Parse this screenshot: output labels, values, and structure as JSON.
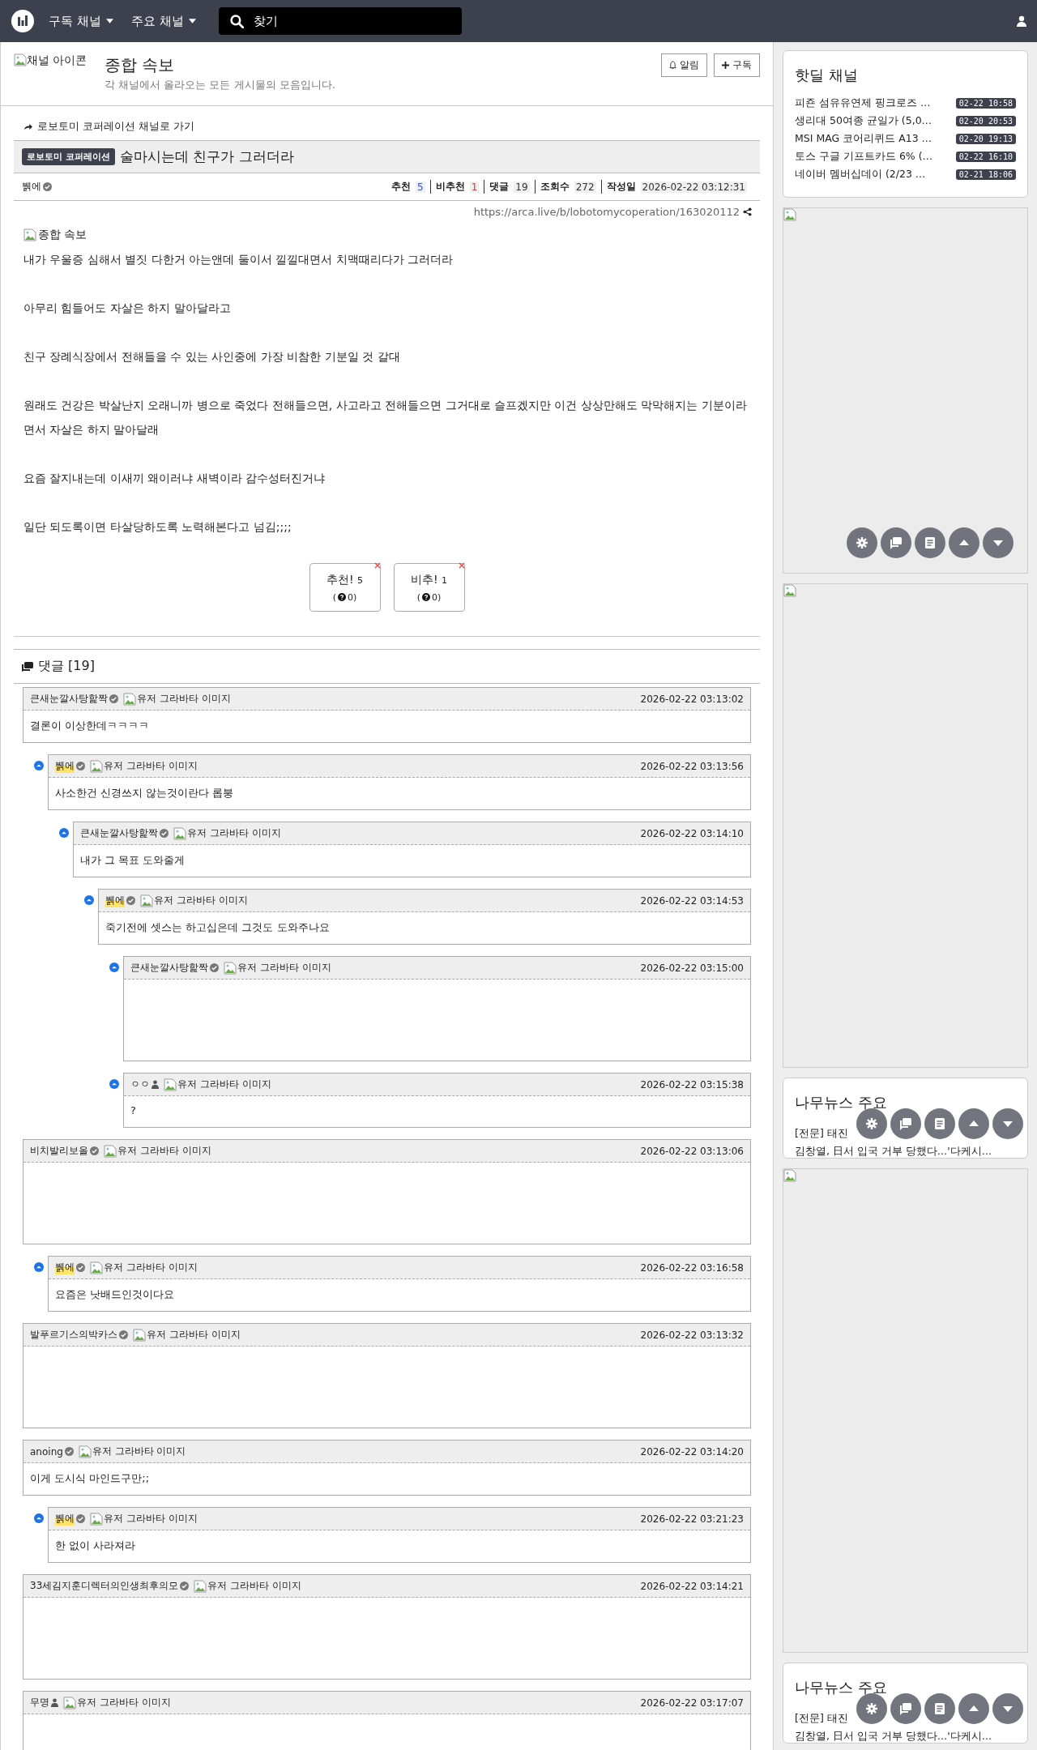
{
  "nav": {
    "menus": [
      {
        "label": "구독 채널"
      },
      {
        "label": "주요 채널"
      }
    ],
    "search": {
      "placeholder": "찾기"
    }
  },
  "channel": {
    "icon_alt": "채널 아이콘",
    "title": "종합 속보",
    "description": "각 채널에서 올라오는 모든 게시물의 모음입니다.",
    "buttons": [
      {
        "kind": "bell",
        "label": "알림"
      },
      {
        "kind": "plus",
        "label": "구독"
      }
    ]
  },
  "post": {
    "back_link": "로보토미 코퍼레이션 채널로 가기",
    "badge": "로보토미 코퍼레이션",
    "title": "술마시는데 친구가 그러더라",
    "author": "뷁에",
    "stats": [
      {
        "label": "추천",
        "value": "5",
        "color": "#3454d1"
      },
      {
        "label": "비추천",
        "value": "1",
        "color": "#d9363e"
      },
      {
        "label": "댓글",
        "value": "19",
        "color": "#333333"
      },
      {
        "label": "조회수",
        "value": "272",
        "color": "#333333"
      },
      {
        "label": "작성일",
        "value": "2026-02-22 03:12:31",
        "color": "#333333"
      }
    ],
    "url": "https://arca.live/b/lobotomycoperation/163020112",
    "image_alt": "종합 속보",
    "paragraphs": [
      "내가 우울증 심해서 별짓 다한거 아는앤데 둘이서 낄낄대면서 치맥때리다가 그러더라",
      "아무리 힘들어도 자살은 하지 말아달라고",
      "친구 장례식장에서 전해들을 수 있는 사인중에 가장 비참한 기분일 것 갈대",
      "원래도 건강은 박살난지 오래니까 병으로 죽었다 전해들으면, 사고라고 전해들으면 그거대로 슬프겠지만 이건 상상만해도 막막해지는 기분이라면서 자살은 하지 말아달래",
      "요즘 잘지내는데 이새끼 왜이러냐 새벽이라 감수성터진거냐",
      "일단 되도록이면 타살당하도록 노력해본다고 넘김;;;;"
    ],
    "votes": [
      {
        "label": "추천!",
        "count": "5",
        "tally_before": "(",
        "tally_after": "0)"
      },
      {
        "label": "비추!",
        "count": "1",
        "tally_before": "(",
        "tally_after": "0)"
      }
    ]
  },
  "comments": {
    "title": "댓글 [19]",
    "items": [
      {
        "author": "큰새눈깔사탕핥짝",
        "verified": true,
        "is_author": false,
        "avatar_alt": "유저 그라바타 이미지",
        "time": "2026-02-22 03:13:02",
        "kind": "text",
        "body": "결론이 이상한데ㅋㅋㅋㅋ",
        "children": [
          {
            "author": "뷁에",
            "verified": true,
            "is_author": true,
            "avatar_alt": "유저 그라바타 이미지",
            "time": "2026-02-22 03:13:56",
            "kind": "text",
            "body": "사소한건 신경쓰지 않는것이란다 롭붕",
            "children": [
              {
                "author": "큰새눈깔사탕핥짝",
                "verified": true,
                "is_author": false,
                "avatar_alt": "유저 그라바타 이미지",
                "time": "2026-02-22 03:14:10",
                "kind": "text",
                "body": "내가 그 목표 도와줄게",
                "children": [
                  {
                    "author": "뷁에",
                    "verified": true,
                    "is_author": true,
                    "avatar_alt": "유저 그라바타 이미지",
                    "time": "2026-02-22 03:14:53",
                    "kind": "text",
                    "body": "죽기전에 셋스는 하고십은데 그것도 도와주나요",
                    "children": [
                      {
                        "author": "큰새눈깔사탕핥짝",
                        "verified": true,
                        "is_author": false,
                        "avatar_alt": "유저 그라바타 이미지",
                        "time": "2026-02-22 03:15:00",
                        "kind": "blank"
                      },
                      {
                        "author": "ㅇㅇ",
                        "verified": false,
                        "is_author": false,
                        "avatar_alt": "유저 그라바타 이미지",
                        "time": "2026-02-22 03:15:38",
                        "kind": "text",
                        "body": "?"
                      }
                    ]
                  }
                ]
              }
            ]
          }
        ]
      },
      {
        "author": "비치발리보올",
        "verified": true,
        "is_author": false,
        "avatar_alt": "유저 그라바타 이미지",
        "time": "2026-02-22 03:13:06",
        "kind": "blank",
        "children": [
          {
            "author": "뷁에",
            "verified": true,
            "is_author": true,
            "avatar_alt": "유저 그라바타 이미지",
            "time": "2026-02-22 03:16:58",
            "kind": "text",
            "body": "요즘은 낫배드인것이다요"
          }
        ]
      },
      {
        "author": "발푸르기스의박카스",
        "verified": true,
        "is_author": false,
        "avatar_alt": "유저 그라바타 이미지",
        "time": "2026-02-22 03:13:32",
        "kind": "blank"
      },
      {
        "author": "anoing",
        "verified": true,
        "is_author": false,
        "avatar_alt": "유저 그라바타 이미지",
        "time": "2026-02-22 03:14:20",
        "kind": "text",
        "body": "이게 도시식 마인드구만;;",
        "children": [
          {
            "author": "뷁에",
            "verified": true,
            "is_author": true,
            "avatar_alt": "유저 그라바타 이미지",
            "time": "2026-02-22 03:21:23",
            "kind": "text",
            "body": "한 없이 사라져라"
          }
        ]
      },
      {
        "author": "33세김지훈디렉터의인생최후의모",
        "verified": true,
        "is_author": false,
        "avatar_alt": "유저 그라바타 이미지",
        "time": "2026-02-22 03:14:21",
        "kind": "blank"
      },
      {
        "author": "무명",
        "verified": false,
        "is_author": false,
        "avatar_alt": "유저 그라바타 이미지",
        "time": "2026-02-22 03:17:07",
        "kind": "blank"
      }
    ]
  },
  "sidebar": [
    {
      "kind": "hotdeal",
      "title": "핫딜 채널",
      "items": [
        {
          "title": "피죤 섬유유연제 핑크로즈 …",
          "time": "02-22 10:58"
        },
        {
          "title": "생리대 50여종 균일가 (5,0…",
          "time": "02-20 20:53"
        },
        {
          "title": "MSI MAG 코어리퀴드 A13 …",
          "time": "02-20 19:13"
        },
        {
          "title": "토스 구글 기프트카드 6% (…",
          "time": "02-22 16:10"
        },
        {
          "title": "네이버 멤버십데이 (2/23 …",
          "time": "02-21 18:06"
        }
      ],
      "float_bar": false
    },
    {
      "kind": "ad",
      "float_bar": true
    },
    {
      "kind": "ad",
      "float_bar": false
    },
    {
      "kind": "news",
      "title": "나무뉴스 주요",
      "items": [
        {
          "title": "[전문] 태진"
        },
        {
          "title": "김창열, 日서 입국 거부 당했다…'다케시…"
        }
      ],
      "float_bar": true
    },
    {
      "kind": "ad",
      "float_bar": false
    },
    {
      "kind": "news",
      "title": "나무뉴스 주요",
      "items": [
        {
          "title": "[전문] 태진"
        },
        {
          "title": "김창열, 日서 입국 거부 당했다…'다케시…"
        }
      ],
      "float_bar": true
    }
  ]
}
